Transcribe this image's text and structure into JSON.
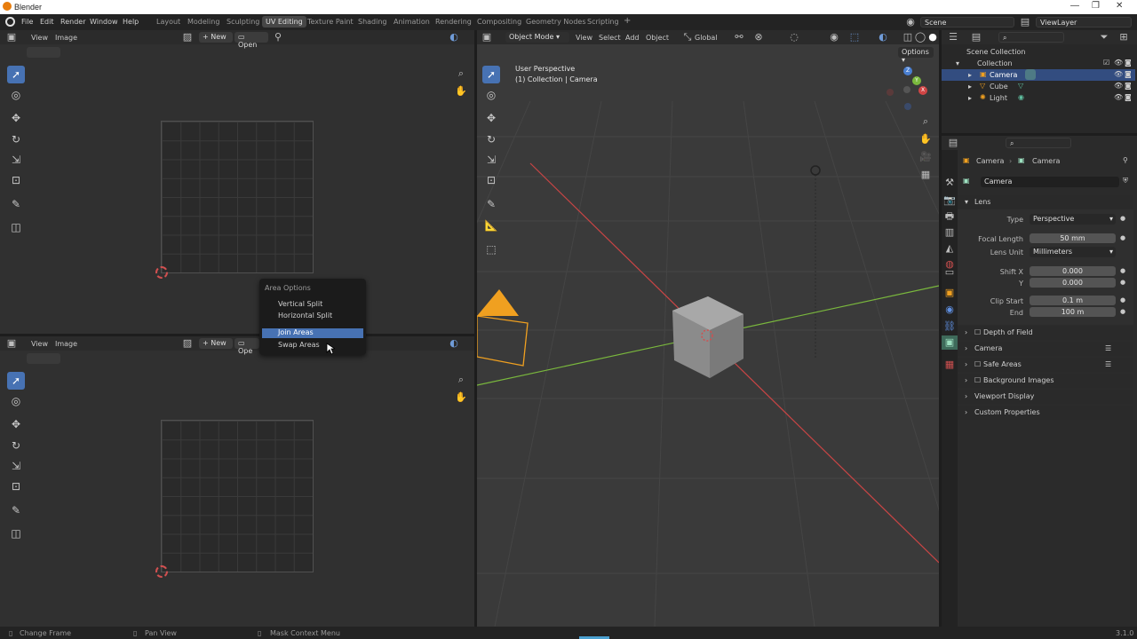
{
  "window": {
    "title": "Blender",
    "controls": [
      "—",
      "❐",
      "✕"
    ]
  },
  "menus": [
    "File",
    "Edit",
    "Render",
    "Window",
    "Help"
  ],
  "workspaces": [
    "Layout",
    "Modeling",
    "Sculpting",
    "UV Editing",
    "Texture Paint",
    "Shading",
    "Animation",
    "Rendering",
    "Compositing",
    "Geometry Nodes",
    "Scripting"
  ],
  "active_workspace": "UV Editing",
  "scene": "Scene",
  "view_layer": "ViewLayer",
  "uv_editor": {
    "menus": [
      "View",
      "Image"
    ],
    "new_label": "New",
    "open_label": "Open",
    "open_label_truncated": "Ope"
  },
  "viewport": {
    "mode": "Object Mode",
    "menus": [
      "View",
      "Select",
      "Add",
      "Object"
    ],
    "transform": "Global",
    "options_label": "Options",
    "overlay_line1": "User Perspective",
    "overlay_line2": "(1) Collection | Camera",
    "gizmo": {
      "x": "X",
      "y": "Y",
      "z": "Z"
    }
  },
  "context_menu": {
    "title": "Area Options",
    "items": [
      "Vertical Split",
      "Horizontal Split",
      "Join Areas",
      "Swap Areas"
    ],
    "highlighted": "Join Areas"
  },
  "outliner": {
    "root": "Scene Collection",
    "collection": "Collection",
    "items": [
      "Camera",
      "Cube",
      "Light"
    ],
    "selected": "Camera"
  },
  "properties": {
    "breadcrumb": [
      "Camera",
      "Camera"
    ],
    "datablock": "Camera",
    "lens_panel": "Lens",
    "type_label": "Type",
    "type_value": "Perspective",
    "focal_label": "Focal Length",
    "focal_value": "50 mm",
    "unit_label": "Lens Unit",
    "unit_value": "Millimeters",
    "shiftx_label": "Shift X",
    "shiftx_value": "0.000",
    "shifty_label": "Y",
    "shifty_value": "0.000",
    "clipstart_label": "Clip Start",
    "clipstart_value": "0.1 m",
    "clipend_label": "End",
    "clipend_value": "100 m",
    "panels": [
      "Depth of Field",
      "Camera",
      "Safe Areas",
      "Background Images",
      "Viewport Display",
      "Custom Properties"
    ]
  },
  "status": {
    "left": "Change Frame",
    "middle": "Pan View",
    "right": "Mask Context Menu",
    "version": "3.1.0"
  },
  "colors": {
    "accent": "#4772b3",
    "camera": "#f0a020",
    "x_axis": "#c84545",
    "y_axis": "#7ab83d"
  }
}
